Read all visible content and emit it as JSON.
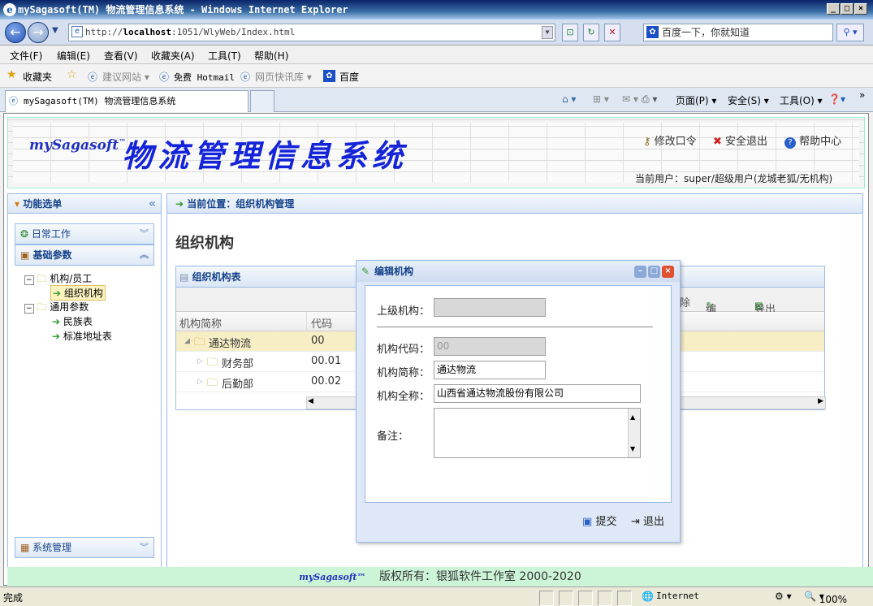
{
  "window": {
    "title": "mySagasoft(TM) 物流管理信息系统 - Windows Internet Explorer",
    "url_prefix": "http://",
    "url_host": "localhost",
    "url_rest": ":1051/WlyWeb/Index.html",
    "search_placeholder": "百度一下，你就知道"
  },
  "menubar": [
    "文件(F)",
    "编辑(E)",
    "查看(V)",
    "收藏夹(A)",
    "工具(T)",
    "帮助(H)"
  ],
  "favorites": {
    "label": "收藏夹",
    "items": [
      "建议网站 ▾",
      "免费 Hotmail",
      "网页快讯库 ▾",
      "百度"
    ]
  },
  "tab": {
    "title": "mySagasoft(TM) 物流管理信息系统",
    "tools": [
      "页面(P) ▾",
      "安全(S) ▾",
      "工具(O) ▾"
    ]
  },
  "header": {
    "brand": "mySagasoft",
    "brand_tm": "™",
    "system_title": "物流管理信息系统",
    "links": [
      "修改口令",
      "安全退出",
      "帮助中心"
    ],
    "current_user": "当前用户：super/超级用户(龙城老狐/无机构)"
  },
  "left_panel": {
    "title": "功能选单",
    "sections": [
      "日常工作",
      "基础参数",
      "系统管理"
    ],
    "tree": [
      {
        "label": "机构/员工",
        "level": 0
      },
      {
        "label": "组织机构",
        "level": 1,
        "selected": true
      },
      {
        "label": "通用参数",
        "level": 0
      },
      {
        "label": "民族表",
        "level": 1
      },
      {
        "label": "标准地址表",
        "level": 1
      }
    ]
  },
  "main_panel": {
    "breadcrumb": "当前位置：组织机构管理",
    "page_title": "组织机构",
    "grid_title": "组织机构表",
    "toolbar": [
      "除",
      "编辑",
      "导出Excel"
    ],
    "columns": [
      "机构简称",
      "代码"
    ],
    "rows": [
      {
        "name": "通达物流",
        "code": "00",
        "selected": true
      },
      {
        "name": "财务部",
        "code": "00.01"
      },
      {
        "name": "后勤部",
        "code": "00.02"
      }
    ]
  },
  "dialog": {
    "title": "编辑机构",
    "fields": {
      "parent_label": "上级机构：",
      "parent_value": "",
      "code_label": "机构代码：",
      "code_value": "00",
      "short_label": "机构简称：",
      "short_value": "通达物流",
      "full_label": "机构全称：",
      "full_value": "山西省通达物流股份有限公司",
      "remark_label": "备注：",
      "remark_value": ""
    },
    "submit": "提交",
    "exit": "退出"
  },
  "footer": {
    "brand": "mySagasoft™",
    "copyright": "版权所有：银狐软件工作室 2000-2020"
  },
  "status": {
    "text": "完成",
    "zone": "Internet",
    "zoom": "100%"
  }
}
